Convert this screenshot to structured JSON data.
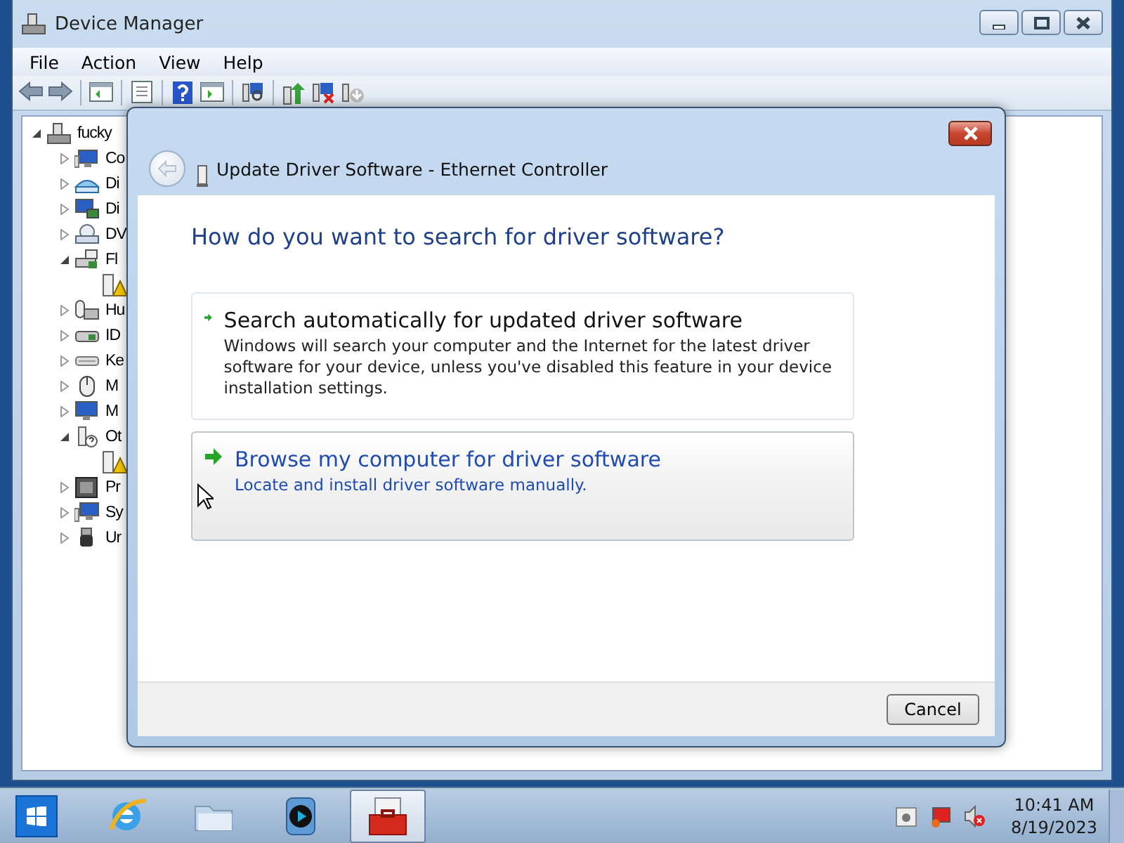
{
  "window": {
    "title": "Device Manager",
    "menu": [
      "File",
      "Action",
      "View",
      "Help"
    ]
  },
  "tree": [
    {
      "label": "fucky",
      "kind": "computer",
      "expanded": true,
      "children": [
        {
          "label": "Co",
          "kind": "category",
          "expanded": false
        },
        {
          "label": "Di",
          "kind": "category",
          "expanded": false
        },
        {
          "label": "Di",
          "kind": "category",
          "expanded": false
        },
        {
          "label": "DV",
          "kind": "category",
          "expanded": false
        },
        {
          "label": "Fl",
          "kind": "category",
          "expanded": true,
          "children": [
            {
              "kind": "warning-device"
            }
          ]
        },
        {
          "label": "Hu",
          "kind": "category",
          "expanded": false
        },
        {
          "label": "ID",
          "kind": "category",
          "expanded": false
        },
        {
          "label": "Ke",
          "kind": "category",
          "expanded": false
        },
        {
          "label": "M",
          "kind": "category",
          "expanded": false
        },
        {
          "label": "M",
          "kind": "category",
          "expanded": false
        },
        {
          "label": "Ot",
          "kind": "category",
          "expanded": true,
          "children": [
            {
              "kind": "warning-device"
            }
          ]
        },
        {
          "label": "Pr",
          "kind": "category",
          "expanded": false
        },
        {
          "label": "Sy",
          "kind": "category",
          "expanded": false
        },
        {
          "label": "Ur",
          "kind": "category",
          "expanded": false
        }
      ]
    }
  ],
  "dialog": {
    "title": "Update Driver Software - Ethernet Controller",
    "heading": "How do you want to search for driver software?",
    "options": [
      {
        "title": "Search automatically for updated driver software",
        "description": "Windows will search your computer and the Internet for the latest driver software for your device, unless you've disabled this feature in your device installation settings.",
        "hovered": false
      },
      {
        "title": "Browse my computer for driver software",
        "description": "Locate and install driver software manually.",
        "hovered": true
      }
    ],
    "buttons": [
      "Cancel"
    ]
  },
  "taskbar": {
    "items": [
      {
        "kind": "ie",
        "active": false
      },
      {
        "kind": "folder",
        "active": false
      },
      {
        "kind": "media",
        "active": false
      },
      {
        "kind": "toolbox",
        "active": true
      }
    ],
    "time": "10:41 AM",
    "date": "8/19/2023"
  }
}
